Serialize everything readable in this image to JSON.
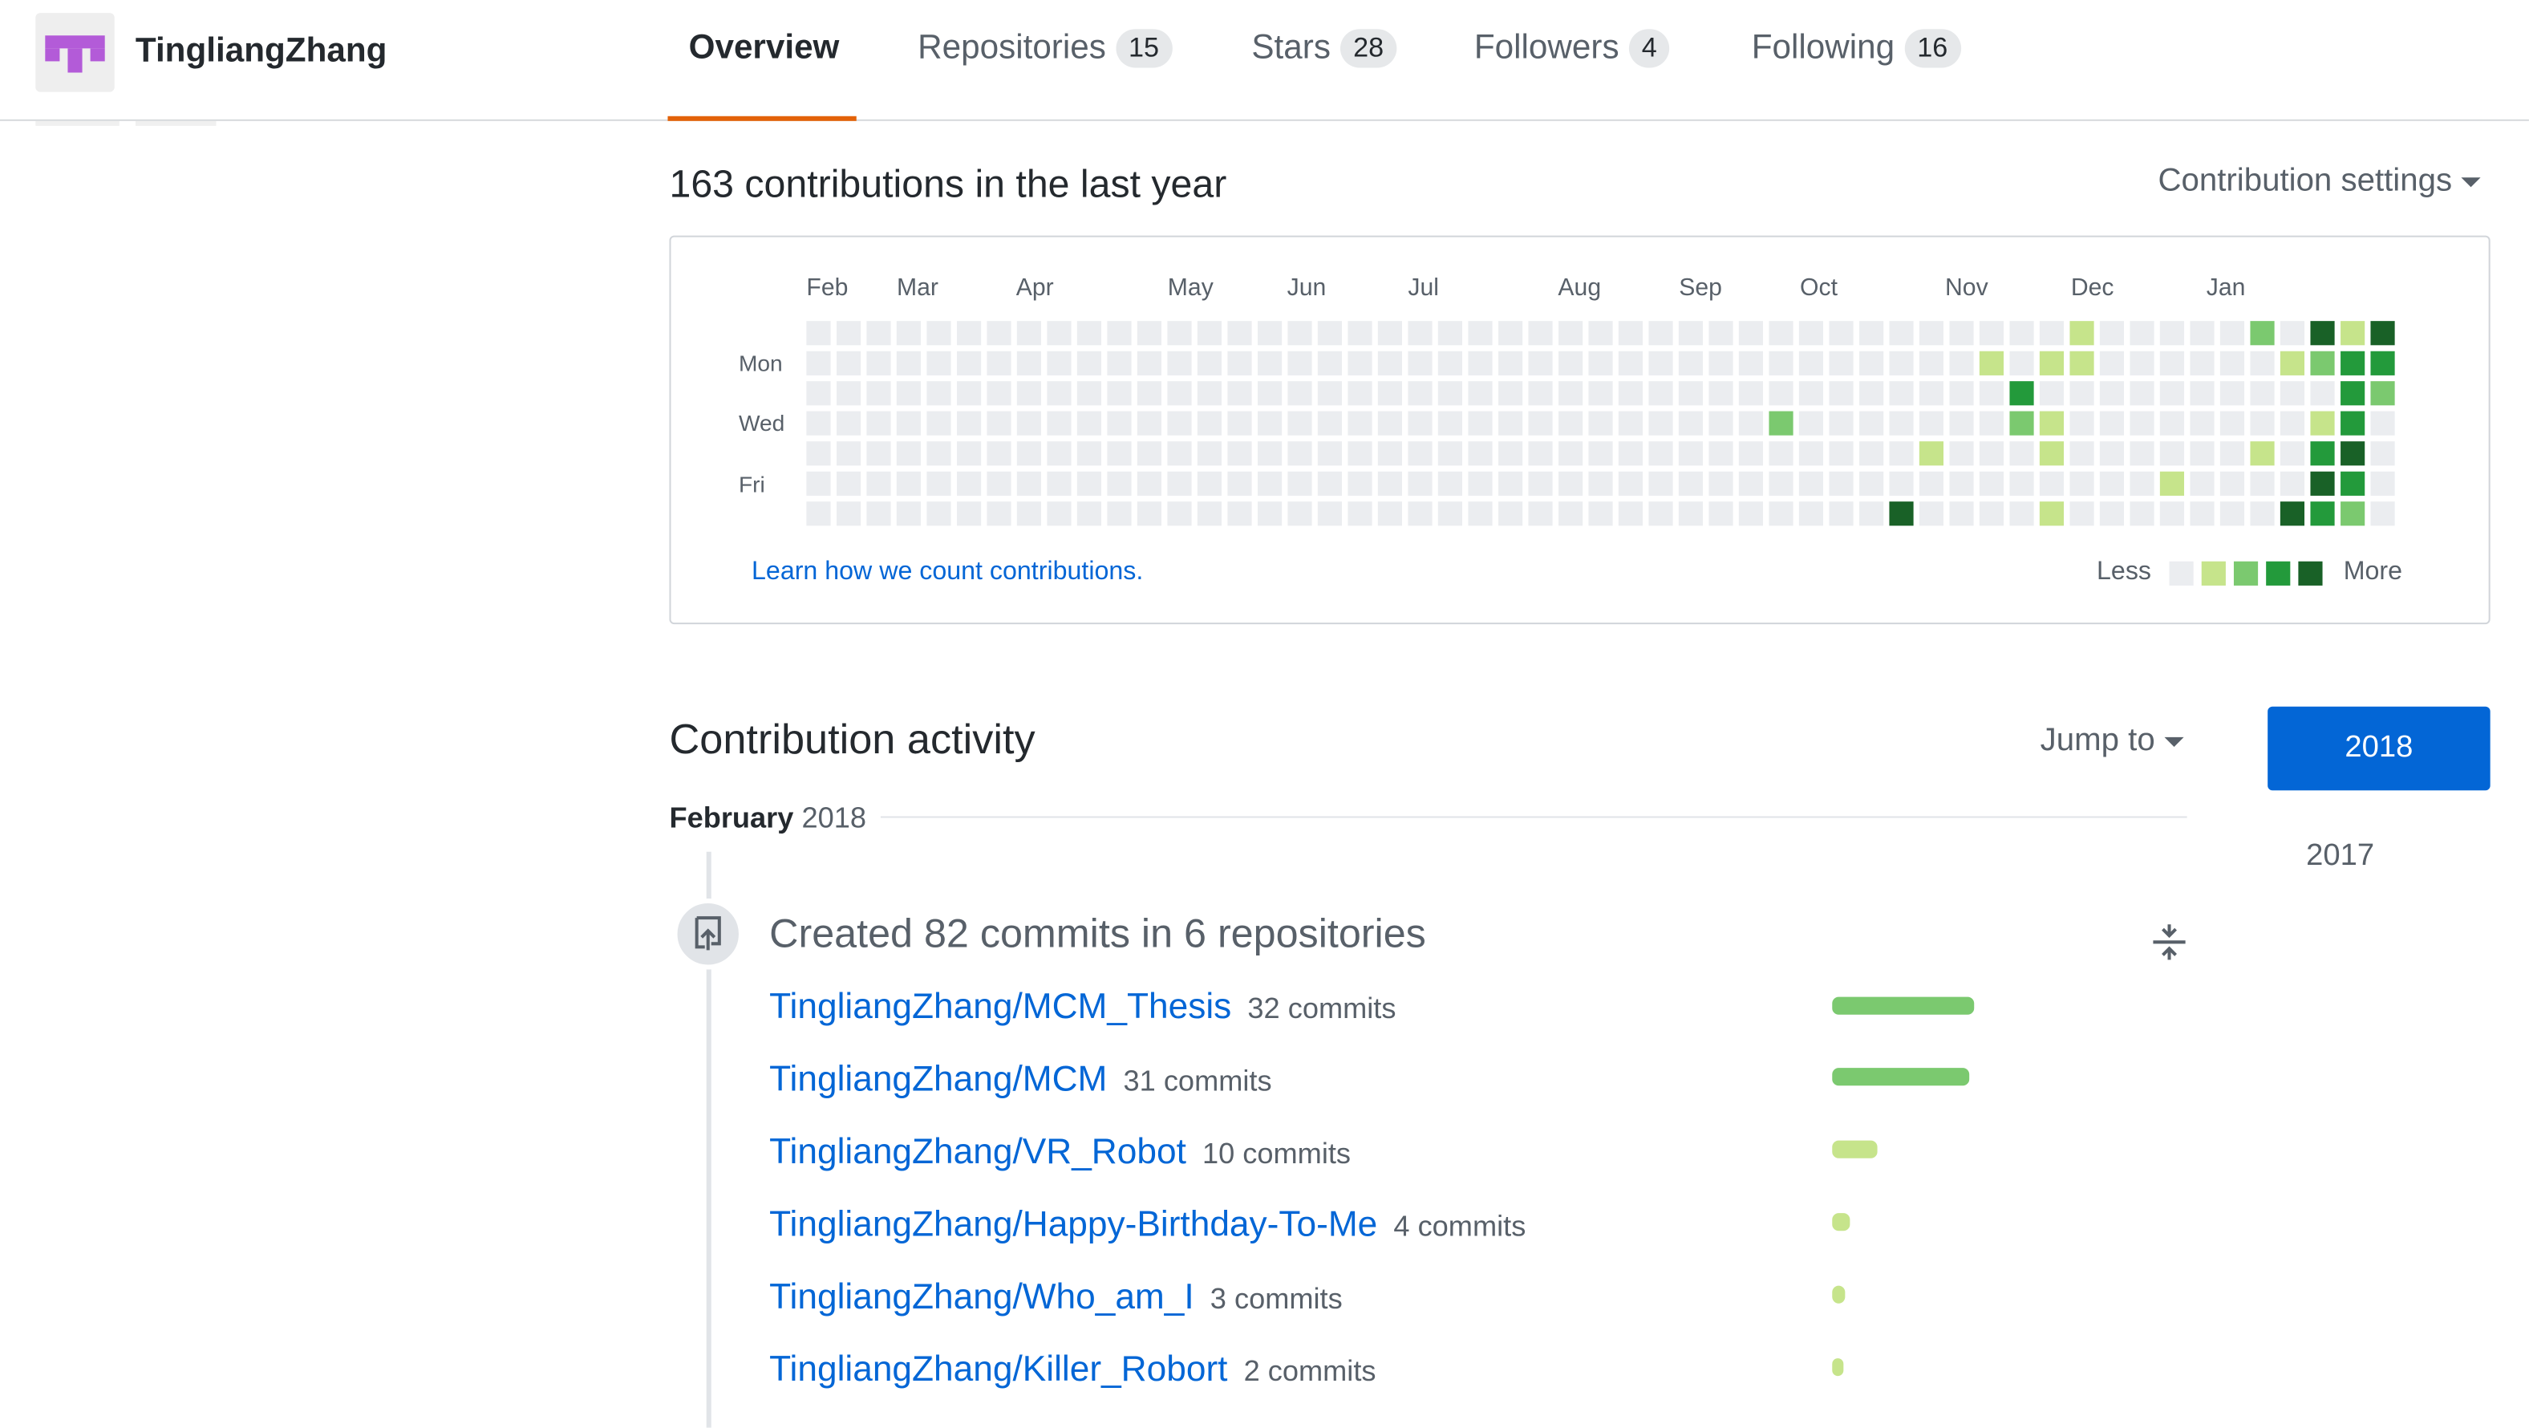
{
  "header": {
    "user_name": "TingliangZhang",
    "tabs": [
      {
        "label": "Overview",
        "count": null,
        "selected": true
      },
      {
        "label": "Repositories",
        "count": "15"
      },
      {
        "label": "Stars",
        "count": "28"
      },
      {
        "label": "Followers",
        "count": "4"
      },
      {
        "label": "Following",
        "count": "16"
      }
    ],
    "accent_color": "#e36209"
  },
  "contributions": {
    "title": "163 contributions in the last year",
    "settings_label": "Contribution settings",
    "months": [
      "Feb",
      "Mar",
      "Apr",
      "May",
      "Jun",
      "Jul",
      "Aug",
      "Sep",
      "Oct",
      "Nov",
      "Dec",
      "Jan"
    ],
    "day_labels": [
      "Mon",
      "Wed",
      "Fri"
    ],
    "learn_link": "Learn how we count contributions.",
    "legend_less": "Less",
    "legend_more": "More",
    "level_colors": [
      "#ebedf0",
      "#c6e48b",
      "#7bc96f",
      "#239a3b",
      "#196127"
    ],
    "weeks": 53,
    "last_week_days": 7,
    "active_days": [
      {
        "week": 32,
        "day": 3,
        "level": 2
      },
      {
        "week": 36,
        "day": 6,
        "level": 4
      },
      {
        "week": 37,
        "day": 4,
        "level": 1
      },
      {
        "week": 39,
        "day": 1,
        "level": 1
      },
      {
        "week": 40,
        "day": 2,
        "level": 3
      },
      {
        "week": 40,
        "day": 3,
        "level": 2
      },
      {
        "week": 41,
        "day": 1,
        "level": 1
      },
      {
        "week": 41,
        "day": 3,
        "level": 1
      },
      {
        "week": 41,
        "day": 4,
        "level": 1
      },
      {
        "week": 41,
        "day": 6,
        "level": 1
      },
      {
        "week": 42,
        "day": 0,
        "level": 1
      },
      {
        "week": 42,
        "day": 1,
        "level": 1
      },
      {
        "week": 45,
        "day": 5,
        "level": 1
      },
      {
        "week": 48,
        "day": 0,
        "level": 2
      },
      {
        "week": 48,
        "day": 4,
        "level": 1
      },
      {
        "week": 49,
        "day": 1,
        "level": 1
      },
      {
        "week": 49,
        "day": 6,
        "level": 4
      },
      {
        "week": 50,
        "day": 0,
        "level": 4
      },
      {
        "week": 50,
        "day": 1,
        "level": 2
      },
      {
        "week": 50,
        "day": 3,
        "level": 1
      },
      {
        "week": 50,
        "day": 4,
        "level": 3
      },
      {
        "week": 50,
        "day": 5,
        "level": 4
      },
      {
        "week": 50,
        "day": 6,
        "level": 3
      },
      {
        "week": 51,
        "day": 0,
        "level": 1
      },
      {
        "week": 51,
        "day": 1,
        "level": 3
      },
      {
        "week": 51,
        "day": 2,
        "level": 3
      },
      {
        "week": 51,
        "day": 3,
        "level": 3
      },
      {
        "week": 51,
        "day": 4,
        "level": 4
      },
      {
        "week": 51,
        "day": 5,
        "level": 3
      },
      {
        "week": 51,
        "day": 6,
        "level": 2
      },
      {
        "week": 52,
        "day": 0,
        "level": 4
      },
      {
        "week": 52,
        "day": 1,
        "level": 3
      },
      {
        "week": 52,
        "day": 2,
        "level": 2
      }
    ]
  },
  "activity": {
    "title": "Contribution activity",
    "jump_to": "Jump to",
    "years": [
      "2018",
      "2017"
    ],
    "month": "February",
    "month_year": "2018",
    "summary": "Created 82 commits in 6 repositories",
    "repos": [
      {
        "name": "TingliangZhang/MCM_Thesis",
        "commits_label": "32 commits",
        "commits": 32,
        "color": "#7bc96f"
      },
      {
        "name": "TingliangZhang/MCM",
        "commits_label": "31 commits",
        "commits": 31,
        "color": "#7bc96f"
      },
      {
        "name": "TingliangZhang/VR_Robot",
        "commits_label": "10 commits",
        "commits": 10,
        "color": "#c6e48b"
      },
      {
        "name": "TingliangZhang/Happy-Birthday-To-Me",
        "commits_label": "4 commits",
        "commits": 4,
        "color": "#c6e48b"
      },
      {
        "name": "TingliangZhang/Who_am_I",
        "commits_label": "3 commits",
        "commits": 3,
        "color": "#c6e48b"
      },
      {
        "name": "TingliangZhang/Killer_Robort",
        "commits_label": "2 commits",
        "commits": 2,
        "color": "#c6e48b"
      }
    ]
  }
}
